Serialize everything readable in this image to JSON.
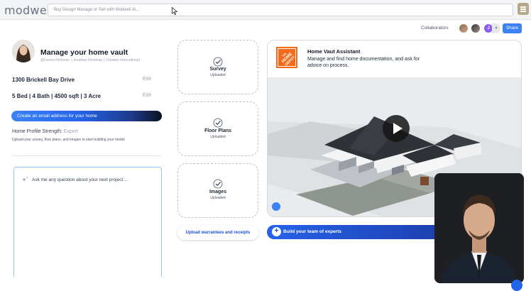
{
  "app": {
    "logo": "modwell"
  },
  "search": {
    "placeholder": "Buy Design Manage or Sell with Modwell AI..."
  },
  "collaborators": {
    "label": "Collaborators",
    "avatar_initial": "J",
    "share_label": "Share"
  },
  "profile": {
    "title": "Manage your home vault",
    "subtitle": "@Donna Reloman | Jonathan Reloman | Christies International",
    "address": "1300 Brickell Bay Drive",
    "specs": "5 Bed | 4 Bath | 4500 sqft | 3 Acre",
    "edit_label": "Edit",
    "email_button": "Create an email address for your home",
    "strength_label": "Home Profile Strength:",
    "strength_level": "Expert",
    "upload_hint": "Upload your survey, floor plans, and images to start building your model"
  },
  "chat": {
    "placeholder": "Ask me any question about your next project ..."
  },
  "uploads": {
    "cards": [
      {
        "title": "Survey",
        "status": "Uploaded"
      },
      {
        "title": "Floor Plans",
        "status": "Uploaded"
      },
      {
        "title": "Images",
        "status": "Uploaded"
      }
    ],
    "warranty_button": "Upload warrantees and receipts"
  },
  "assistant": {
    "title": "Home Vaut Assistant",
    "description": "Manage and find home documentation, and ask for advice on process.",
    "logo_text": "THE HOME DEPOT",
    "team_button": "Build your team of experts"
  },
  "colors": {
    "accent": "#3b82f6",
    "brand_orange": "#f26a1b",
    "menu_tan": "#b8a88a"
  }
}
